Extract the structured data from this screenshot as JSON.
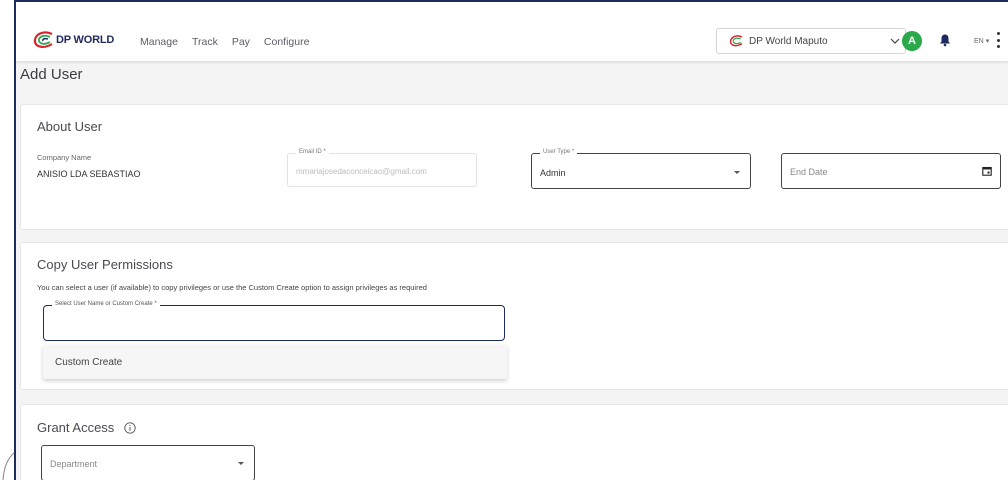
{
  "brand": {
    "name": "DP WORLD"
  },
  "nav": {
    "manage": "Manage",
    "track": "Track",
    "pay": "Pay",
    "configure": "Configure"
  },
  "header": {
    "port": "DP World Maputo",
    "avatar_initial": "A",
    "language": "EN",
    "icons": [
      "dp-world-logo-icon",
      "chevron-down-icon",
      "bell-icon",
      "caret-down-icon",
      "more-vertical-icon"
    ]
  },
  "page": {
    "title": "Add User"
  },
  "about": {
    "title": "About User",
    "company_label": "Company Name",
    "company_value": "ANISIO LDA SEBASTIAO",
    "email_label": "Email ID *",
    "email_value": "mmariajosedaconceicao@gmail.com",
    "user_type_label": "User Type *",
    "user_type_value": "Admin",
    "end_date_placeholder": "End Date"
  },
  "copy": {
    "title": "Copy User Permissions",
    "helper": "You can select a user (if available) to copy privileges or use the Custom Create option to assign privileges as required",
    "select_label": "Select User Name or Custom Create *",
    "option": "Custom Create"
  },
  "grant": {
    "title": "Grant Access",
    "department_placeholder": "Department",
    "icons": [
      "info-icon"
    ]
  },
  "colors": {
    "brand_navy": "#1f2a5e",
    "avatar_green": "#2aa84a",
    "logo_red": "#d9242b"
  }
}
